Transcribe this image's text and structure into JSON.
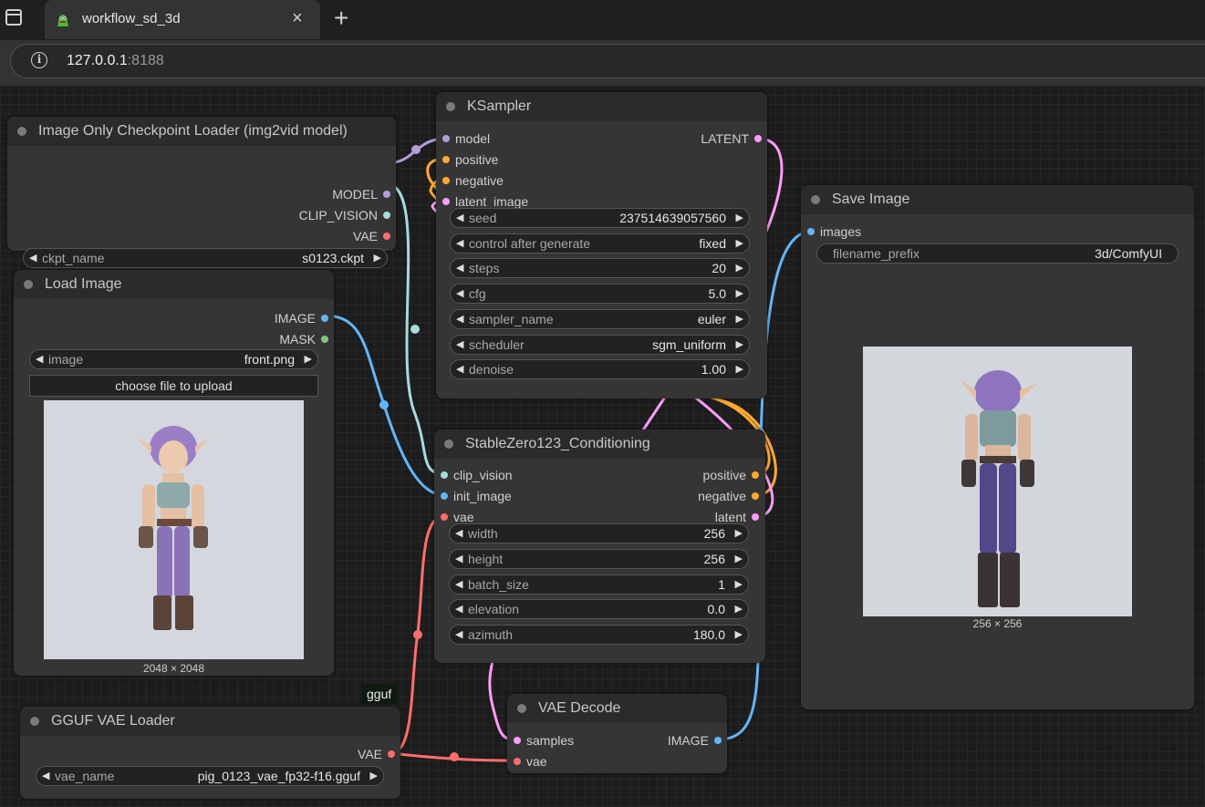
{
  "browser": {
    "tab_title": "workflow_sd_3d",
    "tab_close": "×",
    "new_tab": "+",
    "url_host": "127.0.0.1",
    "url_port": ":8188",
    "info_glyph": "i"
  },
  "colors": {
    "model": "#b39ddb",
    "clip_vision": "#a8dadc",
    "vae": "#ff6e6e",
    "image": "#64b5f6",
    "mask": "#81c784",
    "latent": "#ff9cf9",
    "conditioning": "#ffa931"
  },
  "nodes": {
    "checkpoint_loader": {
      "title": "Image Only Checkpoint Loader (img2vid model)",
      "outputs": [
        "MODEL",
        "CLIP_VISION",
        "VAE"
      ],
      "widgets": [
        {
          "label": "ckpt_name",
          "value": "s0123.ckpt"
        }
      ]
    },
    "load_image": {
      "title": "Load Image",
      "outputs": [
        "IMAGE",
        "MASK"
      ],
      "widgets": [
        {
          "label": "image",
          "value": "front.png"
        }
      ],
      "upload_button": "choose file to upload",
      "image_size": "2048 × 2048"
    },
    "ksampler": {
      "title": "KSampler",
      "inputs": [
        "model",
        "positive",
        "negative",
        "latent_image"
      ],
      "outputs": [
        "LATENT"
      ],
      "widgets": [
        {
          "label": "seed",
          "value": "237514639057560"
        },
        {
          "label": "control after generate",
          "value": "fixed"
        },
        {
          "label": "steps",
          "value": "20"
        },
        {
          "label": "cfg",
          "value": "5.0"
        },
        {
          "label": "sampler_name",
          "value": "euler"
        },
        {
          "label": "scheduler",
          "value": "sgm_uniform"
        },
        {
          "label": "denoise",
          "value": "1.00"
        }
      ]
    },
    "stable_zero123": {
      "title": "StableZero123_Conditioning",
      "inputs": [
        "clip_vision",
        "init_image",
        "vae"
      ],
      "outputs": [
        "positive",
        "negative",
        "latent"
      ],
      "widgets": [
        {
          "label": "width",
          "value": "256"
        },
        {
          "label": "height",
          "value": "256"
        },
        {
          "label": "batch_size",
          "value": "1"
        },
        {
          "label": "elevation",
          "value": "0.0"
        },
        {
          "label": "azimuth",
          "value": "180.0"
        }
      ]
    },
    "save_image": {
      "title": "Save Image",
      "inputs": [
        "images"
      ],
      "widgets": [
        {
          "label": "filename_prefix",
          "value": "3d/ComfyUI"
        }
      ],
      "image_size": "256 × 256"
    },
    "gguf_vae_loader": {
      "badge": "gguf",
      "title": "GGUF VAE Loader",
      "outputs": [
        "VAE"
      ],
      "widgets": [
        {
          "label": "vae_name",
          "value": "pig_0123_vae_fp32-f16.gguf"
        }
      ]
    },
    "vae_decode": {
      "title": "VAE Decode",
      "inputs": [
        "samples",
        "vae"
      ],
      "outputs": [
        "IMAGE"
      ]
    }
  }
}
